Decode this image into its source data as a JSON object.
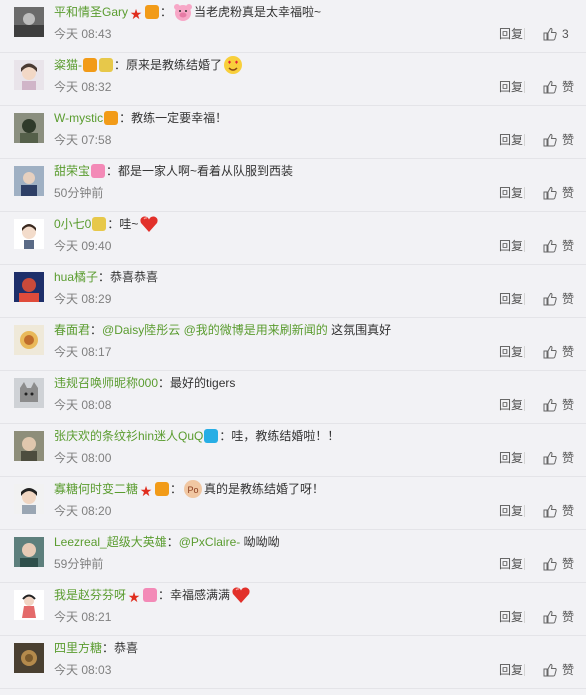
{
  "comments": [
    {
      "user": "平和情圣Gary",
      "badges": [
        "star",
        "fan"
      ],
      "emojis": [
        "pig"
      ],
      "text": "当老虎粉真是太幸福啦~",
      "time": "今天 08:43",
      "reply": "回复",
      "like": "3"
    },
    {
      "user": "粢猫-",
      "badges": [
        "fan",
        "cat"
      ],
      "emojis": [
        "heart-eyes"
      ],
      "text": "原来是教练结婚了",
      "time": "今天 08:32",
      "reply": "回复",
      "like": "赞"
    },
    {
      "user": "W-mystic",
      "badges": [
        "fan"
      ],
      "text": "教练一定要幸福！",
      "time": "今天 07:58",
      "reply": "回复",
      "like": "赞"
    },
    {
      "user": "甜荣宝",
      "badges": [
        "pink"
      ],
      "text": "都是一家人啊~看着从队服到西装",
      "time": "50分钟前",
      "reply": "回复",
      "like": "赞"
    },
    {
      "user": "0小七0",
      "badges": [
        "cat"
      ],
      "emojis": [
        "heart"
      ],
      "text": "哇~",
      "time": "今天 09:40",
      "reply": "回复",
      "like": "赞"
    },
    {
      "user": "hua橘子",
      "badges": [],
      "text": "恭喜恭喜",
      "time": "今天 08:29",
      "reply": "回复",
      "like": "赞"
    },
    {
      "user": "春面君",
      "badges": [],
      "mentions": [
        "@Daisy陸彤云",
        "@我的微博是用来刷新闻的"
      ],
      "text": "这氛围真好",
      "time": "今天 08:17",
      "reply": "回复",
      "like": "赞"
    },
    {
      "user": "违规召唤师昵称000",
      "badges": [],
      "text": "最好的tigers",
      "time": "今天 08:08",
      "reply": "回复",
      "like": "赞"
    },
    {
      "user": "张庆欢的条纹衫hin迷人QuQ",
      "badges": [
        "blue"
      ],
      "text": "哇，教练结婚啦！！",
      "time": "今天 08:00",
      "reply": "回复",
      "like": "赞"
    },
    {
      "user": "寡糖何时变二糖",
      "badges": [
        "star",
        "fan"
      ],
      "emojis": [
        "po"
      ],
      "text": "真的是教练结婚了呀！",
      "time": "今天 08:20",
      "reply": "回复",
      "like": "赞"
    },
    {
      "user": "Leezreal_超级大英雄",
      "badges": [],
      "mentions": [
        "@PxClaire-"
      ],
      "text": "呦呦呦",
      "time": "59分钟前",
      "reply": "回复",
      "like": "赞"
    },
    {
      "user": "我是赵芬芬呀",
      "badges": [
        "star",
        "pink"
      ],
      "emojis": [
        "heart"
      ],
      "text": "幸福感满满",
      "time": "今天 08:21",
      "reply": "回复",
      "like": "赞"
    },
    {
      "user": "四里方糖",
      "badges": [],
      "text": "恭喜",
      "time": "今天 08:03",
      "reply": "回复",
      "like": "赞"
    }
  ],
  "avatars": [
    "avatar-1",
    "avatar-2",
    "avatar-3",
    "avatar-4",
    "avatar-5",
    "avatar-6",
    "avatar-7",
    "avatar-8",
    "avatar-9",
    "avatar-10",
    "avatar-11",
    "avatar-12",
    "avatar-13"
  ],
  "colors": {
    "username": "#5a9c2f",
    "text": "#333333",
    "time": "#808080",
    "background": "#f2f2f5"
  }
}
